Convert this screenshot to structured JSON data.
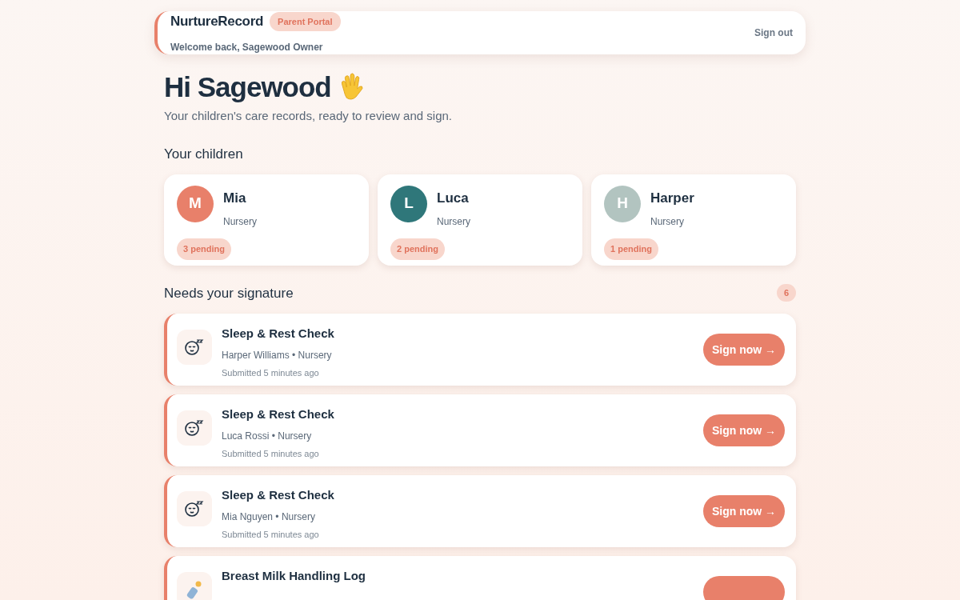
{
  "header": {
    "brand": "NurtureRecord",
    "badge": "Parent Portal",
    "welcome": "Welcome back, Sagewood Owner",
    "sign_out": "Sign out"
  },
  "greeting": {
    "title": "Hi Sagewood",
    "subtitle": "Your children's care records, ready to review and sign."
  },
  "children_section": {
    "title": "Your children",
    "children": [
      {
        "initial": "M",
        "name": "Mia",
        "group": "Nursery",
        "pending": "3 pending",
        "color": "#e8806a"
      },
      {
        "initial": "L",
        "name": "Luca",
        "group": "Nursery",
        "pending": "2 pending",
        "color": "#2f777a"
      },
      {
        "initial": "H",
        "name": "Harper",
        "group": "Nursery",
        "pending": "1 pending",
        "color": "#b2c4c0"
      }
    ]
  },
  "signature_section": {
    "title": "Needs your signature",
    "count": "6",
    "items": [
      {
        "kind": "sleep",
        "title": "Sleep & Rest Check",
        "subtitle": "Harper Williams • Nursery",
        "submitted": "Submitted 5 minutes ago",
        "button": "Sign now →"
      },
      {
        "kind": "sleep",
        "title": "Sleep & Rest Check",
        "subtitle": "Luca Rossi • Nursery",
        "submitted": "Submitted 5 minutes ago",
        "button": "Sign now →"
      },
      {
        "kind": "sleep",
        "title": "Sleep & Rest Check",
        "subtitle": "Mia Nguyen • Nursery",
        "submitted": "Submitted 5 minutes ago",
        "button": "Sign now →"
      },
      {
        "kind": "bottle",
        "title": "Breast Milk Handling Log"
      }
    ]
  }
}
